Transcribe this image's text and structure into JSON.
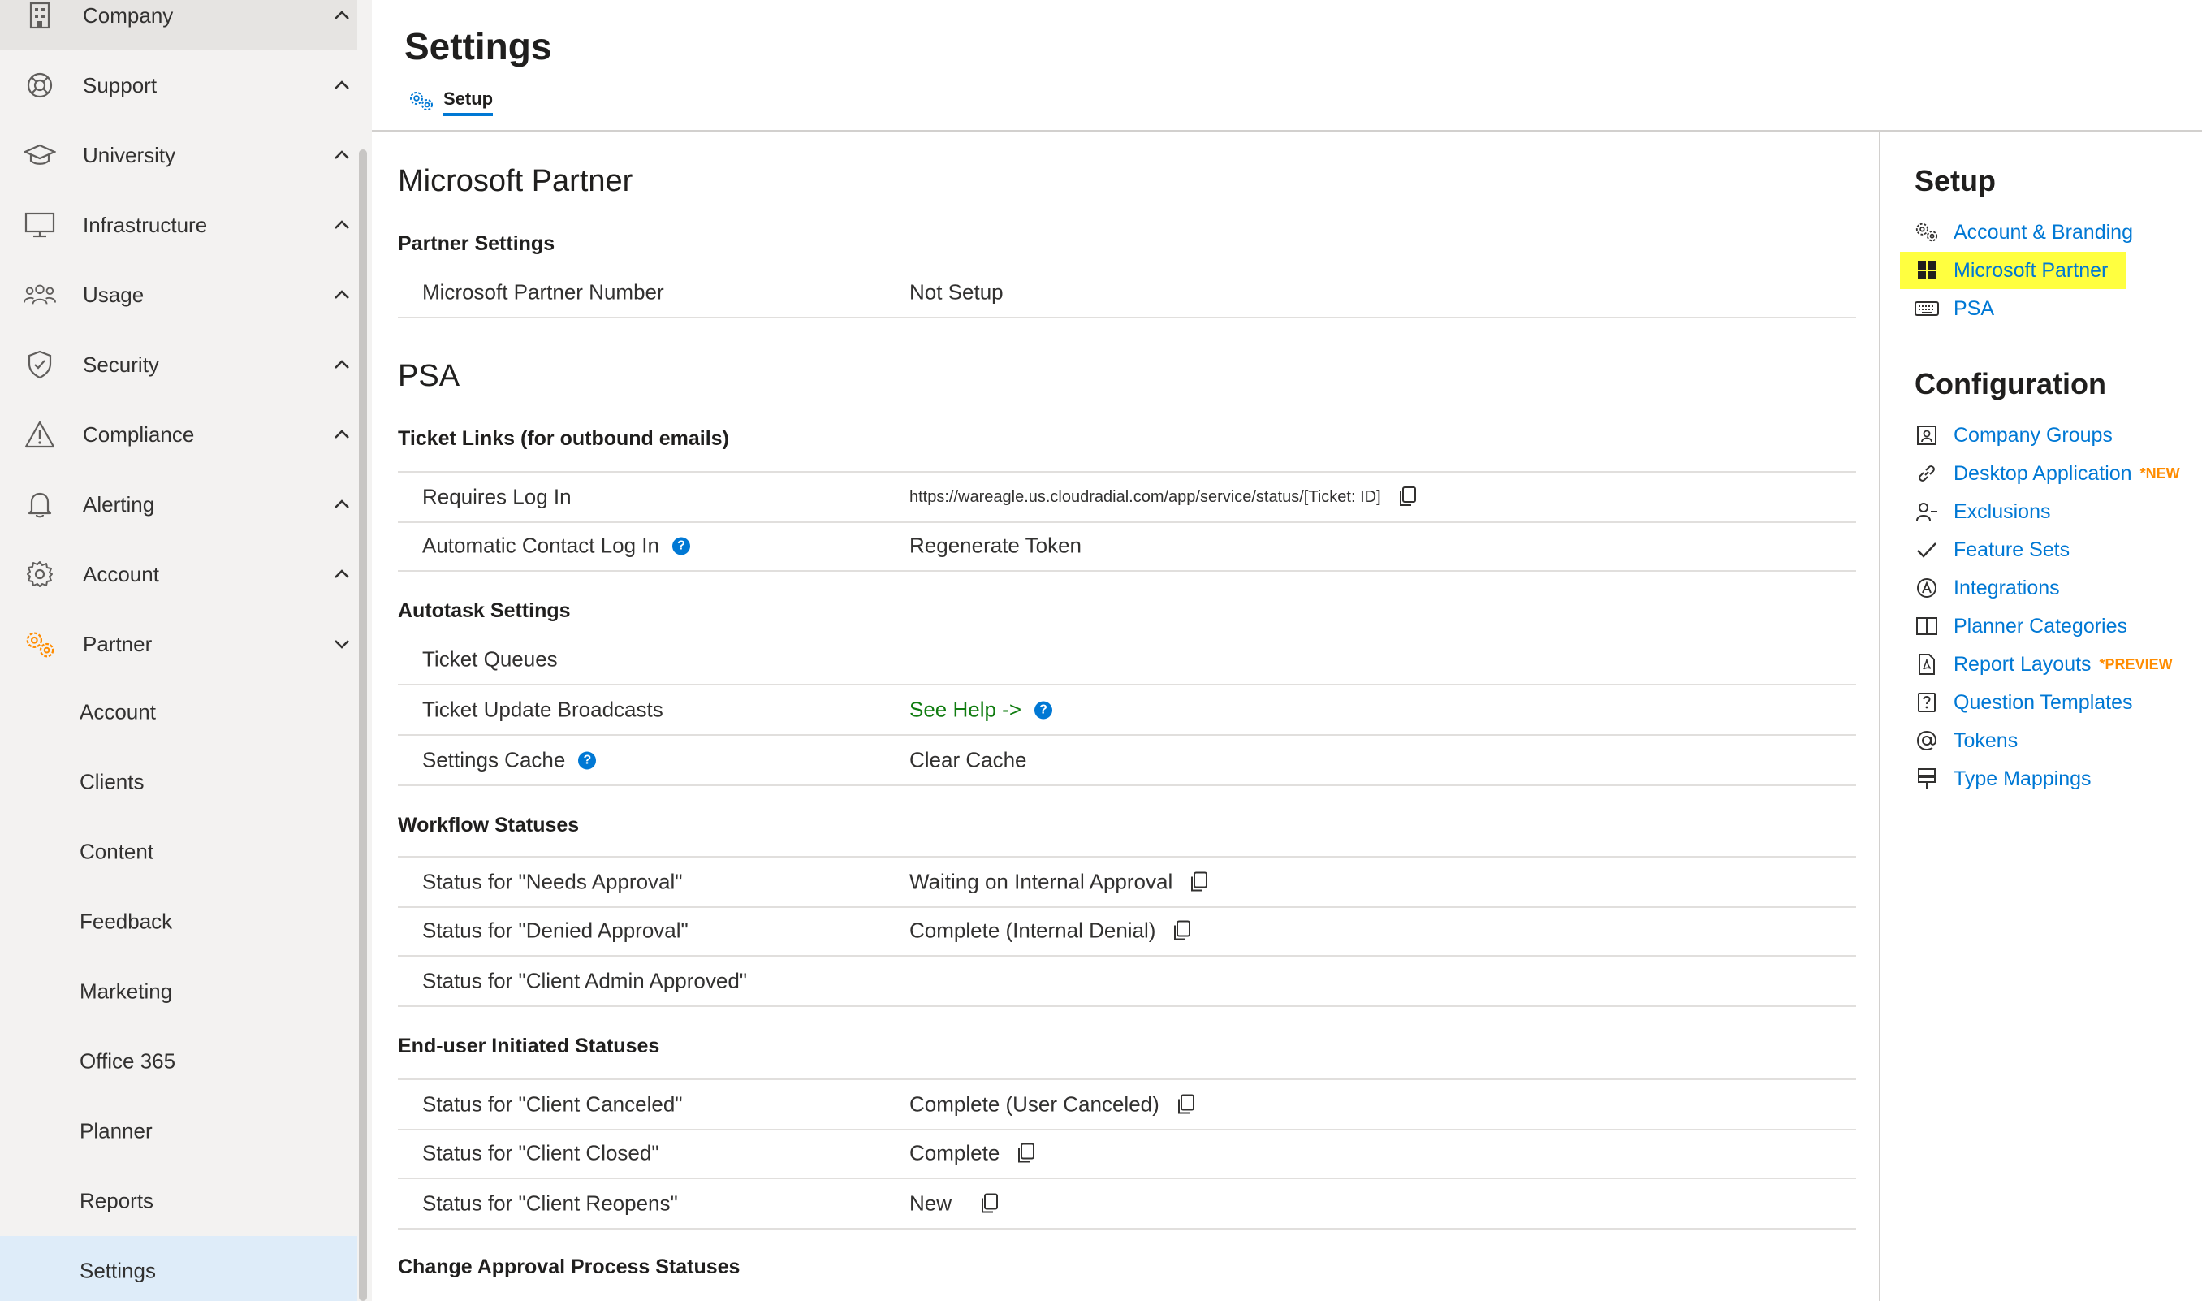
{
  "sidebar": {
    "items": [
      {
        "label": "Company",
        "icon": "building-icon"
      },
      {
        "label": "Support",
        "icon": "lifebuoy-icon"
      },
      {
        "label": "University",
        "icon": "graduation-cap-icon"
      },
      {
        "label": "Infrastructure",
        "icon": "monitor-icon"
      },
      {
        "label": "Usage",
        "icon": "people-icon"
      },
      {
        "label": "Security",
        "icon": "shield-icon"
      },
      {
        "label": "Compliance",
        "icon": "warning-icon"
      },
      {
        "label": "Alerting",
        "icon": "bell-icon"
      },
      {
        "label": "Account",
        "icon": "gear-icon"
      },
      {
        "label": "Partner",
        "icon": "gears-icon"
      }
    ],
    "sub_items": [
      {
        "label": "Account"
      },
      {
        "label": "Clients"
      },
      {
        "label": "Content"
      },
      {
        "label": "Feedback"
      },
      {
        "label": "Marketing"
      },
      {
        "label": "Office 365"
      },
      {
        "label": "Planner"
      },
      {
        "label": "Reports"
      },
      {
        "label": "Settings"
      }
    ]
  },
  "header": {
    "title": "Settings",
    "tab_label": "Setup"
  },
  "main": {
    "ms_partner": {
      "heading": "Microsoft Partner",
      "section": "Partner Settings",
      "number_label": "Microsoft Partner Number",
      "number_value": "Not Setup"
    },
    "psa": {
      "heading": "PSA",
      "ticket_links": {
        "section": "Ticket Links (for outbound emails)",
        "requires_login_label": "Requires Log In",
        "requires_login_value": "https://wareagle.us.cloudradial.com/app/service/status/[Ticket: ID]",
        "auto_contact_label": "Automatic Contact Log In",
        "auto_contact_value": "Regenerate Token"
      },
      "autotask": {
        "section": "Autotask Settings",
        "queues_label": "Ticket Queues",
        "broadcasts_label": "Ticket Update Broadcasts",
        "broadcasts_value": "See Help ->",
        "cache_label": "Settings Cache",
        "cache_value": "Clear Cache"
      },
      "workflow": {
        "section": "Workflow Statuses",
        "needs_label": "Status for \"Needs Approval\"",
        "needs_value": "Waiting on Internal Approval",
        "denied_label": "Status for \"Denied Approval\"",
        "denied_value": "Complete (Internal Denial)",
        "admin_label": "Status for \"Client Admin Approved\""
      },
      "enduser": {
        "section": "End-user Initiated Statuses",
        "canceled_label": "Status for \"Client Canceled\"",
        "canceled_value": "Complete (User Canceled)",
        "closed_label": "Status for \"Client Closed\"",
        "closed_value": "Complete",
        "reopens_label": "Status for \"Client Reopens\"",
        "reopens_value": "New"
      },
      "change_approval": {
        "section": "Change Approval Process Statuses"
      }
    }
  },
  "right_panel": {
    "setup_heading": "Setup",
    "setup_links": [
      {
        "label": "Account & Branding",
        "icon": "gears-icon"
      },
      {
        "label": "Microsoft Partner",
        "icon": "windows-logo-icon"
      },
      {
        "label": "PSA",
        "icon": "keyboard-icon"
      }
    ],
    "config_heading": "Configuration",
    "config_links": [
      {
        "label": "Company Groups",
        "icon": "group-icon",
        "badge": ""
      },
      {
        "label": "Desktop Application",
        "icon": "link-icon",
        "badge": "*NEW"
      },
      {
        "label": "Exclusions",
        "icon": "person-minus-icon",
        "badge": ""
      },
      {
        "label": "Feature Sets",
        "icon": "checkmark-icon",
        "badge": ""
      },
      {
        "label": "Integrations",
        "icon": "app-circle-icon",
        "badge": ""
      },
      {
        "label": "Planner Categories",
        "icon": "board-icon",
        "badge": ""
      },
      {
        "label": "Report Layouts",
        "icon": "pdf-document-icon",
        "badge": "*PREVIEW"
      },
      {
        "label": "Question Templates",
        "icon": "question-box-icon",
        "badge": ""
      },
      {
        "label": "Tokens",
        "icon": "at-sign-icon",
        "badge": ""
      },
      {
        "label": "Type Mappings",
        "icon": "mapping-icon",
        "badge": ""
      }
    ],
    "highlight_color": "#ffff40"
  },
  "colors": {
    "accent": "#0078d4",
    "partner_orange": "#ff8c00",
    "help_green": "#107c10"
  }
}
